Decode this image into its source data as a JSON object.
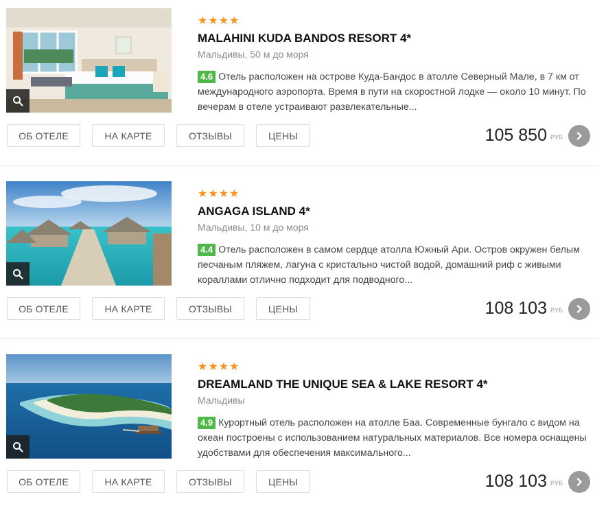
{
  "buttons": {
    "about": "ОБ ОТЕЛЕ",
    "map": "НА КАРТЕ",
    "reviews": "ОТЗЫВЫ",
    "prices": "ЦЕНЫ"
  },
  "currency": "РУБ",
  "colors": {
    "stars": "#f7941d",
    "rating_bg": "#4fb848",
    "arrow_bg": "#9a9a9a"
  },
  "icons": {
    "zoom": "search-icon",
    "next": "chevron-right-icon"
  },
  "hotels": [
    {
      "stars": "★★★★",
      "star_count": 4,
      "name": "MALAHINI KUDA BANDOS RESORT 4*",
      "location": "Мальдивы, 50 м до моря",
      "rating": "4.6",
      "description": "Отель расположен на острове Куда-Бандос в атолле Северный Мале, в 7 км от международного аэропорта. Время в пути на скоростной лодке — около 10 минут. По вечерам в отеле устраивают развлекательные...",
      "price": "105 850"
    },
    {
      "stars": "★★★★",
      "star_count": 4,
      "name": "ANGAGA ISLAND 4*",
      "location": "Мальдивы, 10 м до моря",
      "rating": "4.4",
      "description": "Отель расположен в самом сердце атолла Южный Ари. Остров окружен белым песчаным пляжем, лагуна с кристально чистой водой, домашний риф с живыми кораллами отлично подходит для подводного...",
      "price": "108 103"
    },
    {
      "stars": "★★★★",
      "star_count": 4,
      "name": "DREAMLAND THE UNIQUE SEA & LAKE RESORT 4*",
      "location": "Мальдивы",
      "rating": "4.9",
      "description": "Курортный отель расположен на атолле Баа. Современные бунгало с видом на океан построены с использованием натуральных материалов. Все номера оснащены удобствами для обеспечения максимального...",
      "price": "108 103"
    }
  ]
}
